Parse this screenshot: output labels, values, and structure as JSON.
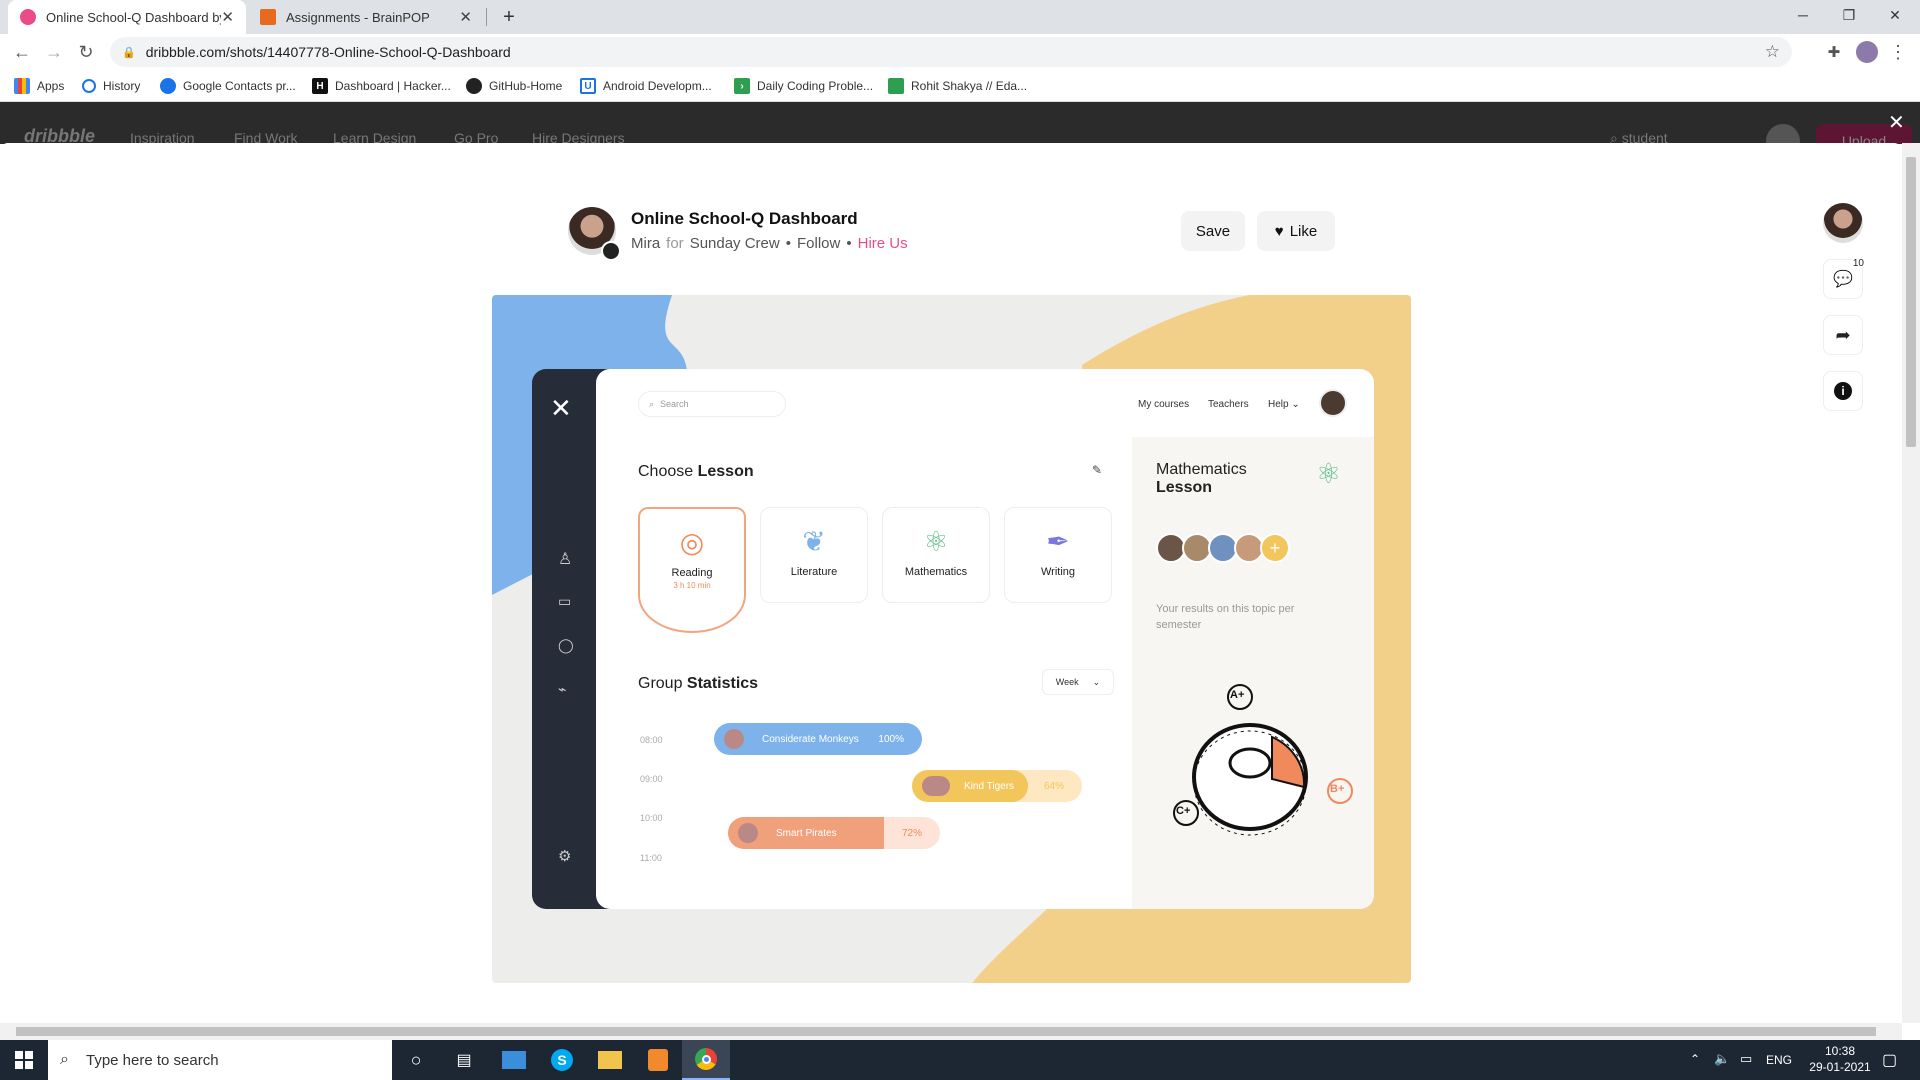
{
  "browser": {
    "tabs": [
      {
        "title": "Online School-Q Dashboard by M"
      },
      {
        "title": "Assignments - BrainPOP"
      }
    ],
    "url": "dribbble.com/shots/14407778-Online-School-Q-Dashboard",
    "bookmarks": [
      {
        "label": "Apps"
      },
      {
        "label": "History"
      },
      {
        "label": "Google Contacts pr..."
      },
      {
        "label": "Dashboard | Hacker..."
      },
      {
        "label": "GitHub-Home"
      },
      {
        "label": "Android Developm..."
      },
      {
        "label": "Daily Coding Proble..."
      },
      {
        "label": "Rohit Shakya // Eda..."
      }
    ]
  },
  "dribbble": {
    "nav": [
      "Inspiration",
      "Find Work",
      "Learn Design",
      "Go Pro",
      "Hire Designers"
    ],
    "search": "student",
    "upload": "Upload",
    "shot_title": "Online School-Q Dashboard",
    "author": "Mira",
    "for_word": "for",
    "team": "Sunday Crew",
    "follow": "Follow",
    "hire": "Hire Us",
    "save": "Save",
    "like": "Like",
    "comment_count": "10"
  },
  "dashboard": {
    "search_placeholder": "Search",
    "nav": [
      "My courses",
      "Teachers",
      "Help"
    ],
    "choose": "Choose",
    "lesson_word": "Lesson",
    "lessons": [
      {
        "name": "Reading",
        "time": "3 h 10 min"
      },
      {
        "name": "Literature"
      },
      {
        "name": "Mathematics"
      },
      {
        "name": "Writing"
      }
    ],
    "group": "Group",
    "statistics": "Statistics",
    "period": "Week",
    "times": [
      "08:00",
      "09:00",
      "10:00",
      "11:00"
    ],
    "bars": [
      {
        "name": "Considerate Monkeys",
        "pct": "100%"
      },
      {
        "name": "Kind Tigers",
        "pct": "64%"
      },
      {
        "name": "Smart Pirates",
        "pct": "72%"
      }
    ],
    "panel_title_1": "Mathematics",
    "panel_title_2": "Lesson",
    "panel_results": "Your results on this topic per semester",
    "grades": [
      "A+",
      "B+",
      "C+"
    ]
  },
  "taskbar": {
    "search": "Type here to search",
    "lang": "ENG",
    "time": "10:38",
    "date": "29-01-2021"
  }
}
